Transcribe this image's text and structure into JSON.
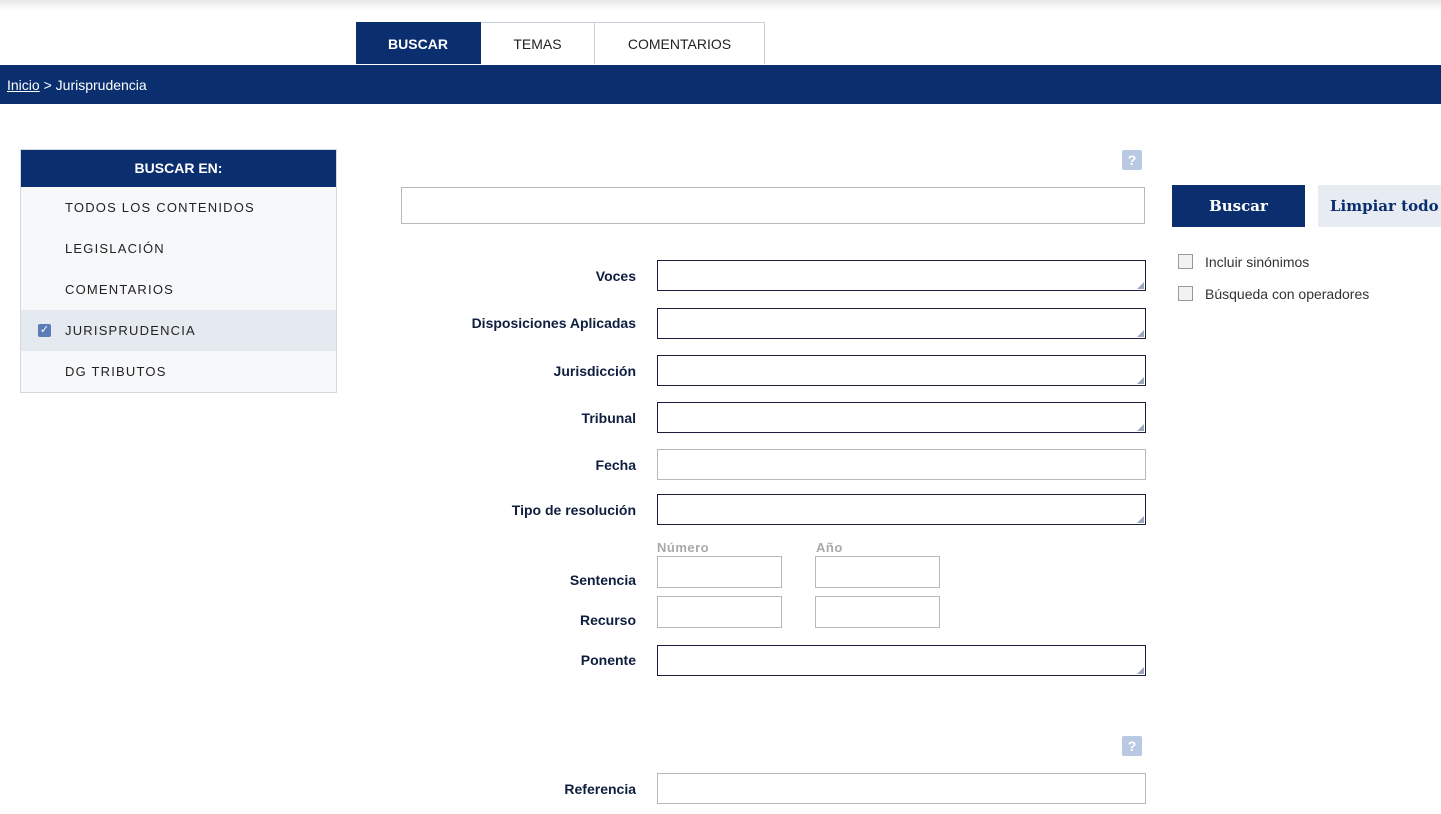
{
  "tabs": [
    {
      "label": "BUSCAR",
      "active": true
    },
    {
      "label": "TEMAS",
      "active": false
    },
    {
      "label": "COMENTARIOS",
      "active": false
    }
  ],
  "breadcrumb": {
    "home": "Inicio",
    "separator": " > ",
    "current": "Jurisprudencia"
  },
  "sidebar": {
    "title": "BUSCAR EN:",
    "items": [
      {
        "label": "TODOS LOS CONTENIDOS",
        "checked": false
      },
      {
        "label": "LEGISLACIÓN",
        "checked": false
      },
      {
        "label": "COMENTARIOS",
        "checked": false
      },
      {
        "label": "JURISPRUDENCIA",
        "checked": true
      },
      {
        "label": "DG TRIBUTOS",
        "checked": false
      }
    ]
  },
  "search": {
    "value": "",
    "buscar_label": "Buscar",
    "limpiar_label": "Limpiar todo",
    "options": [
      {
        "label": "Incluir sinónimos",
        "checked": false
      },
      {
        "label": "Búsqueda con operadores",
        "checked": false
      }
    ],
    "help_icon": "help-icon"
  },
  "form": {
    "voces": "Voces",
    "disposiciones": "Disposiciones Aplicadas",
    "jurisdiccion": "Jurisdicción",
    "tribunal": "Tribunal",
    "fecha": "Fecha",
    "tipo_resolucion": "Tipo de resolución",
    "numero": "Número",
    "anio": "Año",
    "sentencia": "Sentencia",
    "recurso": "Recurso",
    "ponente": "Ponente",
    "referencia": "Referencia"
  },
  "colors": {
    "brand": "#0b2e6f",
    "help": "#b9c9e2"
  }
}
